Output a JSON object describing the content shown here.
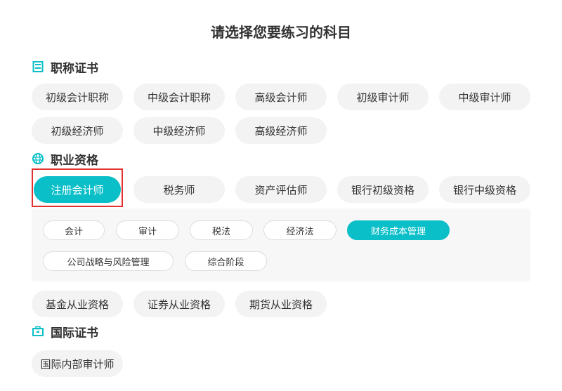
{
  "title": "请选择您要练习的科目",
  "accent": "#0abfc8",
  "sections": [
    {
      "label": "职称证书",
      "icon": "calculator-icon",
      "items": [
        "初级会计职称",
        "中级会计职称",
        "高级会计师",
        "初级审计师",
        "中级审计师",
        "初级经济师",
        "中级经济师",
        "高级经济师"
      ]
    },
    {
      "label": "职业资格",
      "icon": "globe-icon",
      "items": [
        "注册会计师",
        "税务师",
        "资产评估师",
        "银行初级资格",
        "银行中级资格"
      ],
      "selected": "注册会计师",
      "subjects": [
        "会计",
        "审计",
        "税法",
        "经济法",
        "财务成本管理",
        "公司战略与风险管理",
        "综合阶段"
      ],
      "selected_subject": "财务成本管理",
      "more_items": [
        "基金从业资格",
        "证券从业资格",
        "期货从业资格"
      ]
    },
    {
      "label": "国际证书",
      "icon": "briefcase-icon",
      "items": [
        "国际内部审计师"
      ]
    }
  ]
}
